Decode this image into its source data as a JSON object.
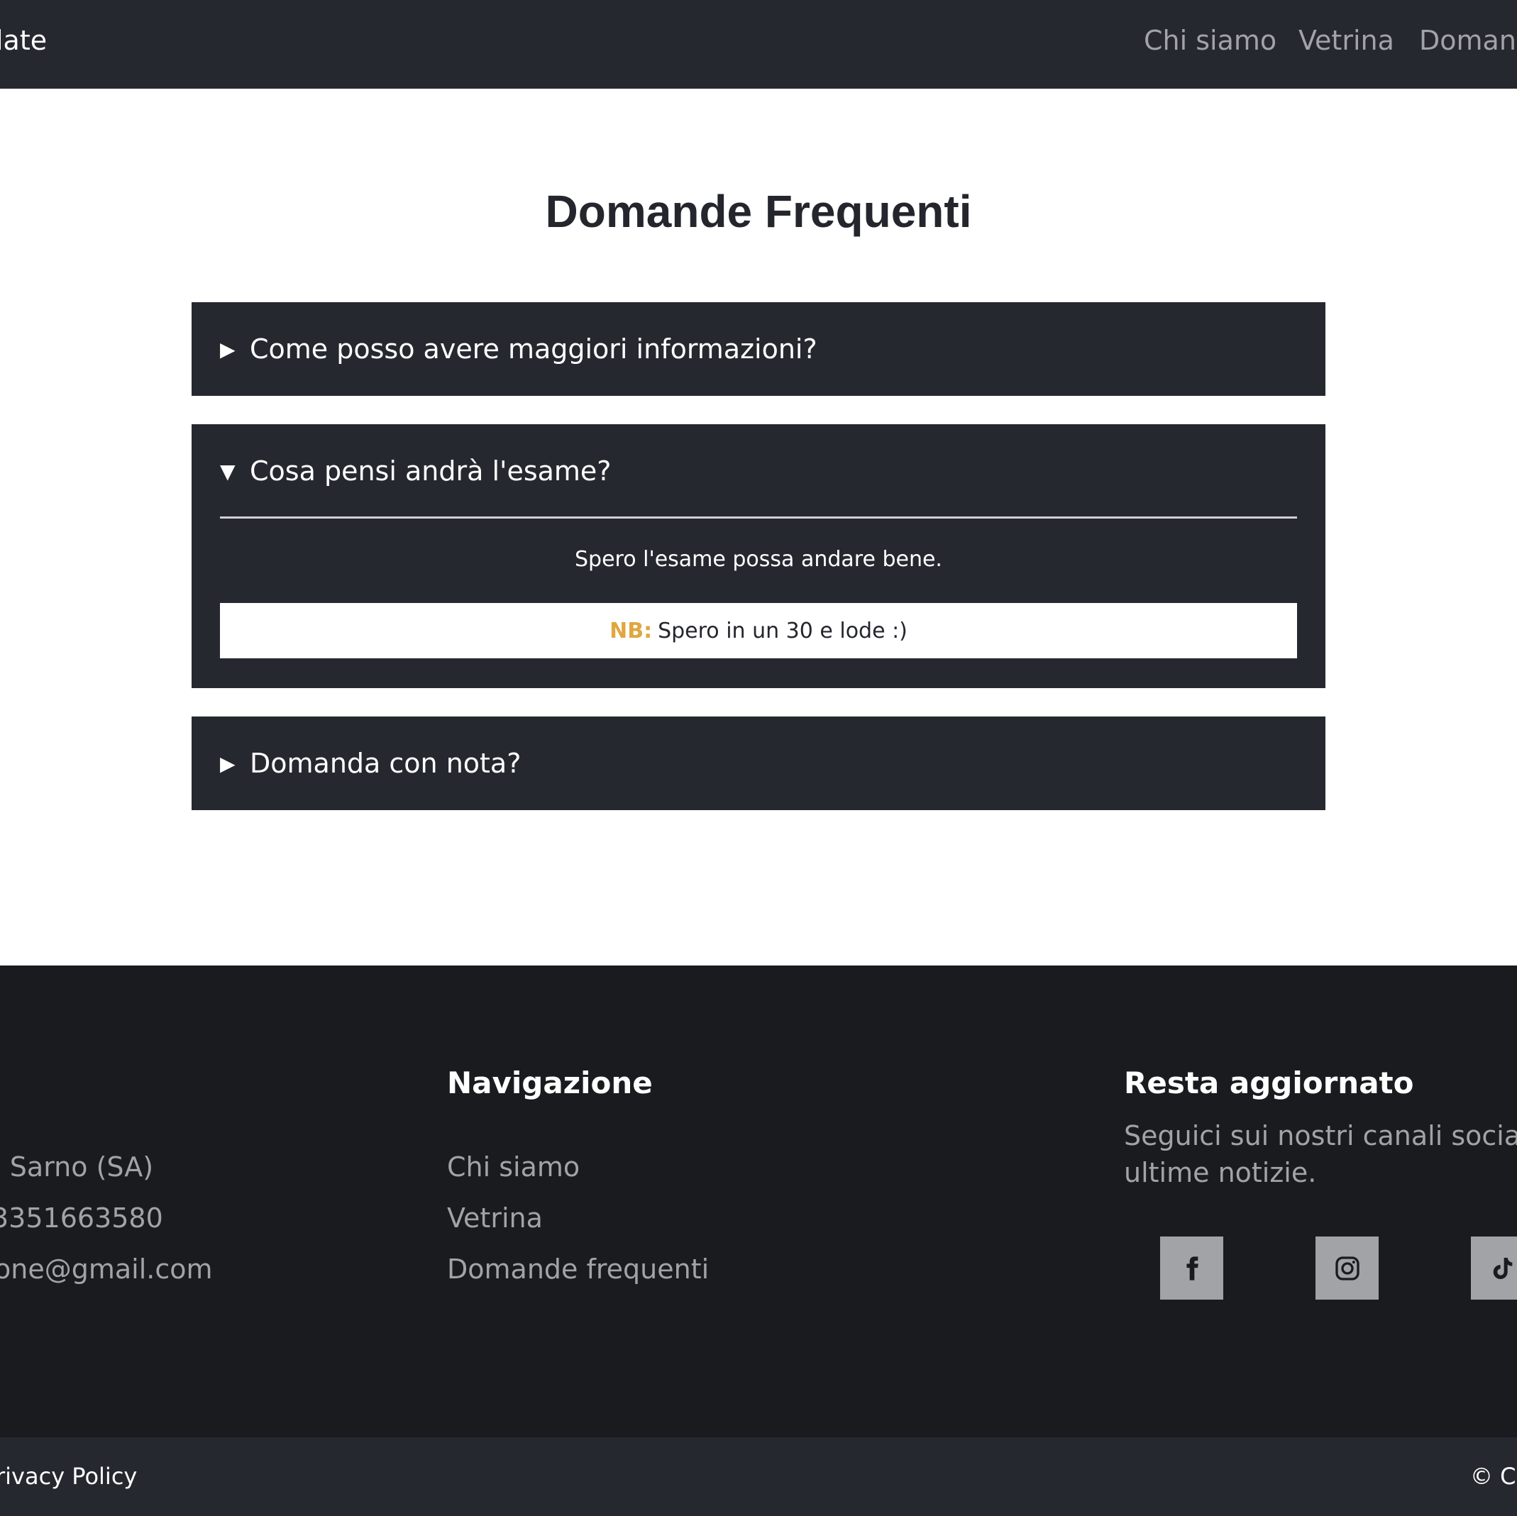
{
  "navbar": {
    "brand": "late",
    "links": [
      "Chi siamo",
      "Vetrina",
      "Domand"
    ]
  },
  "title": "Domande Frequenti",
  "faq": [
    {
      "question": "Come posso avere maggiori informazioni?",
      "open": false,
      "arrow": "▶"
    },
    {
      "question": "Cosa pensi andrà l'esame?",
      "open": true,
      "arrow": "▼",
      "answer": "Spero l'esame possa andare bene.",
      "note_label": "NB:",
      "note_text": "Spero in un 30 e lode :)"
    },
    {
      "question": "Domanda con nota?",
      "open": false,
      "arrow": "▶"
    }
  ],
  "footer": {
    "contacts": [
      "- Sarno (SA)",
      "3351663580",
      "one@gmail.com"
    ],
    "nav_heading": "Navigazione",
    "nav_links": [
      "Chi siamo",
      "Vetrina",
      "Domande frequenti"
    ],
    "social_heading": "Resta aggiornato",
    "social_text_line1": "Seguici sui nostri canali social pe",
    "social_text_line2": "ultime notizie.",
    "social_icons": [
      "facebook-icon",
      "instagram-icon",
      "tiktok-icon"
    ]
  },
  "bottom": {
    "privacy": "rivacy Policy",
    "copyright": "© Co"
  },
  "colors": {
    "dark": "#262830",
    "footer": "#1a1b1f",
    "muted_text": "#a2a3a7",
    "accent": "#e0a73f"
  }
}
